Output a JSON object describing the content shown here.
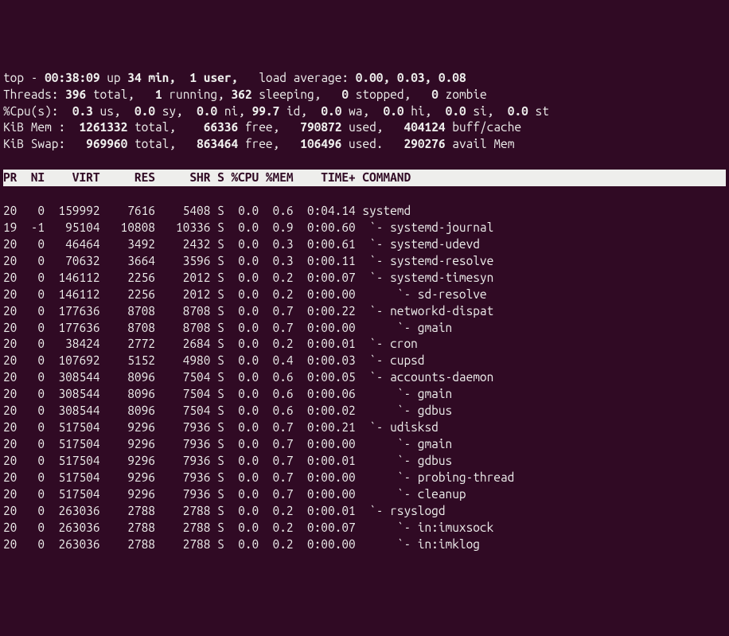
{
  "summary": {
    "line1_a": "top - ",
    "time": "00:38:09",
    "line1_b": " up ",
    "uptime": "34 min,",
    "line1_c": "  ",
    "users": "1 user,",
    "line1_d": "   load average: ",
    "load": "0.00, 0.03, 0.08",
    "threads_lbl": "Threads: ",
    "th_total": "396",
    "th_total_s": " total,   ",
    "th_run": "1",
    "th_run_s": " running, ",
    "th_sleep": "362",
    "th_sleep_s": " sleeping,   ",
    "th_stop": "0",
    "th_stop_s": " stopped,   ",
    "th_zomb": "0",
    "th_zomb_s": " zombie",
    "cpu_lbl": "%Cpu(s):  ",
    "cpu_us": "0.3 ",
    "cpu_us_s": "us,  ",
    "cpu_sy": "0.0 ",
    "cpu_sy_s": "sy,  ",
    "cpu_ni": "0.0 ",
    "cpu_ni_s": "ni, ",
    "cpu_id": "99.7 ",
    "cpu_id_s": "id,  ",
    "cpu_wa": "0.0 ",
    "cpu_wa_s": "wa,  ",
    "cpu_hi": "0.0 ",
    "cpu_hi_s": "hi,  ",
    "cpu_si": "0.0 ",
    "cpu_si_s": "si,  ",
    "cpu_st": "0.0 ",
    "cpu_st_s": "st",
    "mem_lbl": "KiB Mem :  ",
    "mem_total": "1261332 ",
    "mem_total_s": "total,    ",
    "mem_free": "66336 ",
    "mem_free_s": "free,   ",
    "mem_used": "790872 ",
    "mem_used_s": "used,   ",
    "mem_buff": "404124 ",
    "mem_buff_s": "buff/cache",
    "swap_lbl": "KiB Swap:   ",
    "sw_total": "969960 ",
    "sw_total_s": "total,   ",
    "sw_free": "863464 ",
    "sw_free_s": "free,   ",
    "sw_used": "106496 ",
    "sw_used_s": "used.   ",
    "sw_avail": "290276 ",
    "sw_avail_s": "avail Mem "
  },
  "columns": {
    "pr": "PR",
    "ni": "NI",
    "virt": "VIRT",
    "res": "RES",
    "shr": "SHR",
    "s": "S",
    "cpu": "%CPU",
    "mem": "%MEM",
    "time": "TIME+",
    "command": "COMMAND"
  },
  "rows": [
    {
      "pr": "20",
      "ni": "0",
      "virt": "159992",
      "res": "7616",
      "shr": "5408",
      "s": "S",
      "cpu": "0.0",
      "mem": "0.6",
      "time": "0:04.14",
      "command": "systemd"
    },
    {
      "pr": "19",
      "ni": "-1",
      "virt": "95104",
      "res": "10808",
      "shr": "10336",
      "s": "S",
      "cpu": "0.0",
      "mem": "0.9",
      "time": "0:00.60",
      "command": " `- systemd-journal"
    },
    {
      "pr": "20",
      "ni": "0",
      "virt": "46464",
      "res": "3492",
      "shr": "2432",
      "s": "S",
      "cpu": "0.0",
      "mem": "0.3",
      "time": "0:00.61",
      "command": " `- systemd-udevd"
    },
    {
      "pr": "20",
      "ni": "0",
      "virt": "70632",
      "res": "3664",
      "shr": "3596",
      "s": "S",
      "cpu": "0.0",
      "mem": "0.3",
      "time": "0:00.11",
      "command": " `- systemd-resolve"
    },
    {
      "pr": "20",
      "ni": "0",
      "virt": "146112",
      "res": "2256",
      "shr": "2012",
      "s": "S",
      "cpu": "0.0",
      "mem": "0.2",
      "time": "0:00.07",
      "command": " `- systemd-timesyn"
    },
    {
      "pr": "20",
      "ni": "0",
      "virt": "146112",
      "res": "2256",
      "shr": "2012",
      "s": "S",
      "cpu": "0.0",
      "mem": "0.2",
      "time": "0:00.00",
      "command": "     `- sd-resolve"
    },
    {
      "pr": "20",
      "ni": "0",
      "virt": "177636",
      "res": "8708",
      "shr": "8708",
      "s": "S",
      "cpu": "0.0",
      "mem": "0.7",
      "time": "0:00.22",
      "command": " `- networkd-dispat"
    },
    {
      "pr": "20",
      "ni": "0",
      "virt": "177636",
      "res": "8708",
      "shr": "8708",
      "s": "S",
      "cpu": "0.0",
      "mem": "0.7",
      "time": "0:00.00",
      "command": "     `- gmain"
    },
    {
      "pr": "20",
      "ni": "0",
      "virt": "38424",
      "res": "2772",
      "shr": "2684",
      "s": "S",
      "cpu": "0.0",
      "mem": "0.2",
      "time": "0:00.01",
      "command": " `- cron"
    },
    {
      "pr": "20",
      "ni": "0",
      "virt": "107692",
      "res": "5152",
      "shr": "4980",
      "s": "S",
      "cpu": "0.0",
      "mem": "0.4",
      "time": "0:00.03",
      "command": " `- cupsd"
    },
    {
      "pr": "20",
      "ni": "0",
      "virt": "308544",
      "res": "8096",
      "shr": "7504",
      "s": "S",
      "cpu": "0.0",
      "mem": "0.6",
      "time": "0:00.05",
      "command": " `- accounts-daemon"
    },
    {
      "pr": "20",
      "ni": "0",
      "virt": "308544",
      "res": "8096",
      "shr": "7504",
      "s": "S",
      "cpu": "0.0",
      "mem": "0.6",
      "time": "0:00.06",
      "command": "     `- gmain"
    },
    {
      "pr": "20",
      "ni": "0",
      "virt": "308544",
      "res": "8096",
      "shr": "7504",
      "s": "S",
      "cpu": "0.0",
      "mem": "0.6",
      "time": "0:00.02",
      "command": "     `- gdbus"
    },
    {
      "pr": "20",
      "ni": "0",
      "virt": "517504",
      "res": "9296",
      "shr": "7936",
      "s": "S",
      "cpu": "0.0",
      "mem": "0.7",
      "time": "0:00.21",
      "command": " `- udisksd"
    },
    {
      "pr": "20",
      "ni": "0",
      "virt": "517504",
      "res": "9296",
      "shr": "7936",
      "s": "S",
      "cpu": "0.0",
      "mem": "0.7",
      "time": "0:00.00",
      "command": "     `- gmain"
    },
    {
      "pr": "20",
      "ni": "0",
      "virt": "517504",
      "res": "9296",
      "shr": "7936",
      "s": "S",
      "cpu": "0.0",
      "mem": "0.7",
      "time": "0:00.01",
      "command": "     `- gdbus"
    },
    {
      "pr": "20",
      "ni": "0",
      "virt": "517504",
      "res": "9296",
      "shr": "7936",
      "s": "S",
      "cpu": "0.0",
      "mem": "0.7",
      "time": "0:00.00",
      "command": "     `- probing-thread"
    },
    {
      "pr": "20",
      "ni": "0",
      "virt": "517504",
      "res": "9296",
      "shr": "7936",
      "s": "S",
      "cpu": "0.0",
      "mem": "0.7",
      "time": "0:00.00",
      "command": "     `- cleanup"
    },
    {
      "pr": "20",
      "ni": "0",
      "virt": "263036",
      "res": "2788",
      "shr": "2788",
      "s": "S",
      "cpu": "0.0",
      "mem": "0.2",
      "time": "0:00.01",
      "command": " `- rsyslogd"
    },
    {
      "pr": "20",
      "ni": "0",
      "virt": "263036",
      "res": "2788",
      "shr": "2788",
      "s": "S",
      "cpu": "0.0",
      "mem": "0.2",
      "time": "0:00.07",
      "command": "     `- in:imuxsock"
    },
    {
      "pr": "20",
      "ni": "0",
      "virt": "263036",
      "res": "2788",
      "shr": "2788",
      "s": "S",
      "cpu": "0.0",
      "mem": "0.2",
      "time": "0:00.00",
      "command": "     `- in:imklog"
    }
  ]
}
